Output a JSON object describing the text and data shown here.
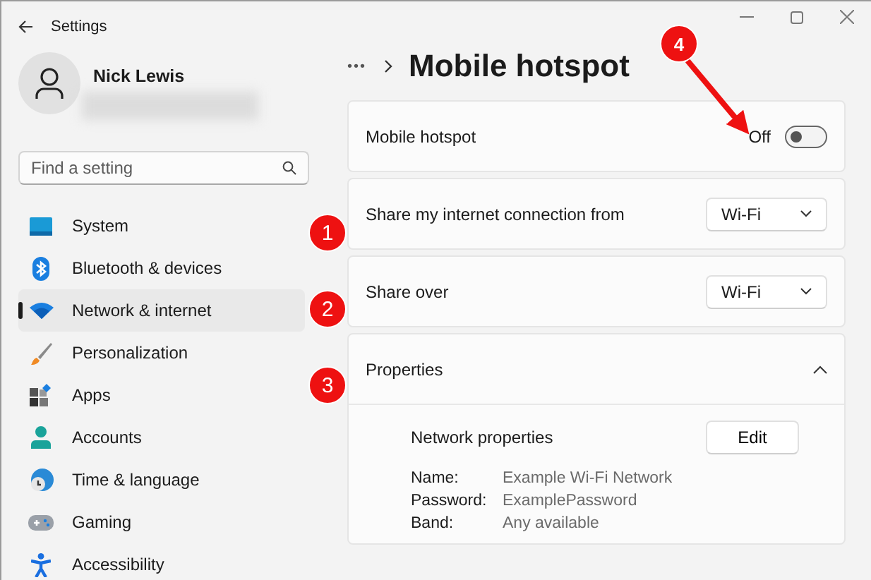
{
  "window": {
    "title": "Settings"
  },
  "user": {
    "name": "Nick Lewis"
  },
  "search": {
    "placeholder": "Find a setting"
  },
  "sidebar": {
    "items": [
      {
        "label": "System",
        "kind": "system",
        "selected": false
      },
      {
        "label": "Bluetooth & devices",
        "kind": "bluetooth",
        "selected": false
      },
      {
        "label": "Network & internet",
        "kind": "network",
        "selected": true
      },
      {
        "label": "Personalization",
        "kind": "brush",
        "selected": false
      },
      {
        "label": "Apps",
        "kind": "apps",
        "selected": false
      },
      {
        "label": "Accounts",
        "kind": "accounts",
        "selected": false
      },
      {
        "label": "Time & language",
        "kind": "time",
        "selected": false
      },
      {
        "label": "Gaming",
        "kind": "gaming",
        "selected": false
      },
      {
        "label": "Accessibility",
        "kind": "accessibility",
        "selected": false
      }
    ]
  },
  "breadcrumb": {
    "more": "•••",
    "title": "Mobile hotspot"
  },
  "settings": [
    {
      "kind": "toggle",
      "label": "Mobile hotspot",
      "state_text": "Off",
      "on": false
    },
    {
      "kind": "dropdown",
      "label": "Share my internet connection from",
      "value": "Wi-Fi"
    },
    {
      "kind": "dropdown",
      "label": "Share over",
      "value": "Wi-Fi"
    },
    {
      "kind": "expander",
      "label": "Properties",
      "expanded": true,
      "section_label": "Network properties",
      "button": "Edit",
      "fields": [
        {
          "name": "Name:",
          "value": "Example Wi-Fi Network"
        },
        {
          "name": "Password:",
          "value": "ExamplePassword"
        },
        {
          "name": "Band:",
          "value": "Any available"
        }
      ]
    }
  ],
  "callouts": [
    {
      "label": "1",
      "kind": "badge"
    },
    {
      "label": "2",
      "kind": "badge"
    },
    {
      "label": "3",
      "kind": "badge"
    },
    {
      "label": "4",
      "kind": "arrow"
    }
  ]
}
